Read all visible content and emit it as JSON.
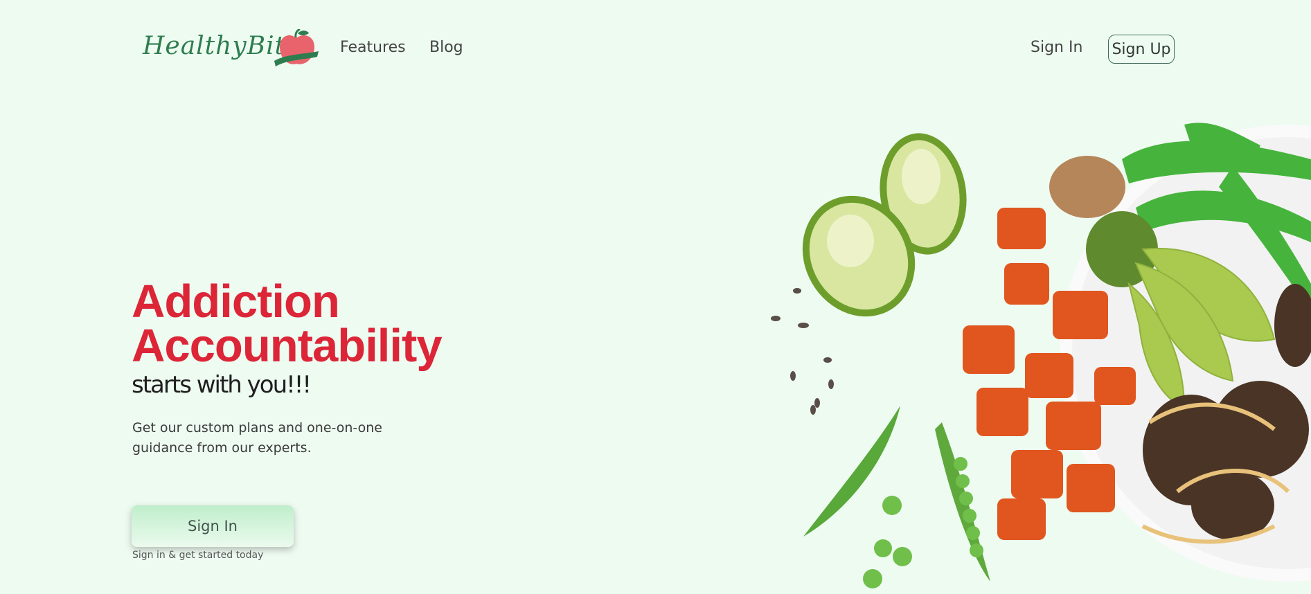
{
  "brand": {
    "logo_text": "HealthyBite",
    "logo_icon": "apple-icon"
  },
  "nav": {
    "features": "Features",
    "blog": "Blog",
    "sign_in": "Sign In",
    "sign_up": "Sign Up"
  },
  "hero": {
    "title_line1": "Addiction",
    "title_line2": "Accountability",
    "subtitle": "starts with you!!!",
    "description": "Get our custom plans and one-on-one guidance from our experts.",
    "cta_label": "Sign In",
    "cta_note": "Sign in & get started today"
  },
  "colors": {
    "background": "#eefbf1",
    "accent_red": "#dc2638",
    "brand_green": "#2e7d4f",
    "button_gradient_top": "#bfeecb"
  },
  "image": {
    "subject": "bowl-of-food-image"
  }
}
